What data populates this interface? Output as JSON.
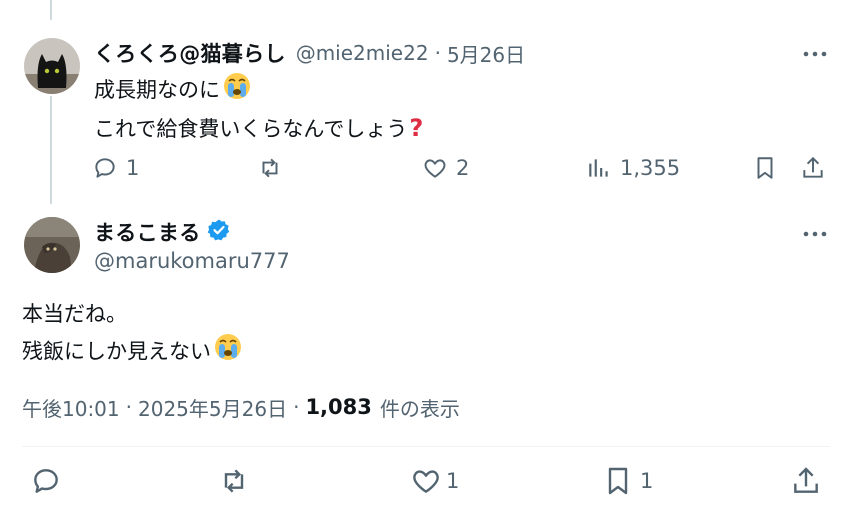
{
  "reply": {
    "display_name": "くろくろ@猫暮らし",
    "handle": "@mie2mie22",
    "separator": "·",
    "date": "5月26日",
    "lines": [
      "成長期なのに",
      "これで給食費いくらなんでしょう"
    ],
    "actions": {
      "replies": "1",
      "reposts": "",
      "likes": "2",
      "views": "1,355"
    }
  },
  "main_post": {
    "display_name": "まるこまる",
    "handle": "@marukomaru777",
    "lines": [
      "本当だね。",
      "残飯にしか見えない"
    ],
    "meta": {
      "time": "午後10:01",
      "sep1": "·",
      "date": "2025年5月26日",
      "sep2": "·",
      "views_count": "1,083",
      "views_label": "件の表示"
    },
    "actions": {
      "replies": "",
      "reposts": "",
      "likes": "1",
      "bookmarks": "1"
    }
  },
  "icons": [
    "reply-icon",
    "repost-icon",
    "like-icon",
    "views-icon",
    "bookmark-icon",
    "share-icon",
    "more-icon",
    "verified-badge-icon",
    "crying-face-emoji",
    "question-mark-emoji"
  ],
  "colors": {
    "text": "#0f1419",
    "muted": "#536471",
    "verified": "#1d9bf0",
    "question": "#dd2e44",
    "line": "#cfd9de"
  }
}
